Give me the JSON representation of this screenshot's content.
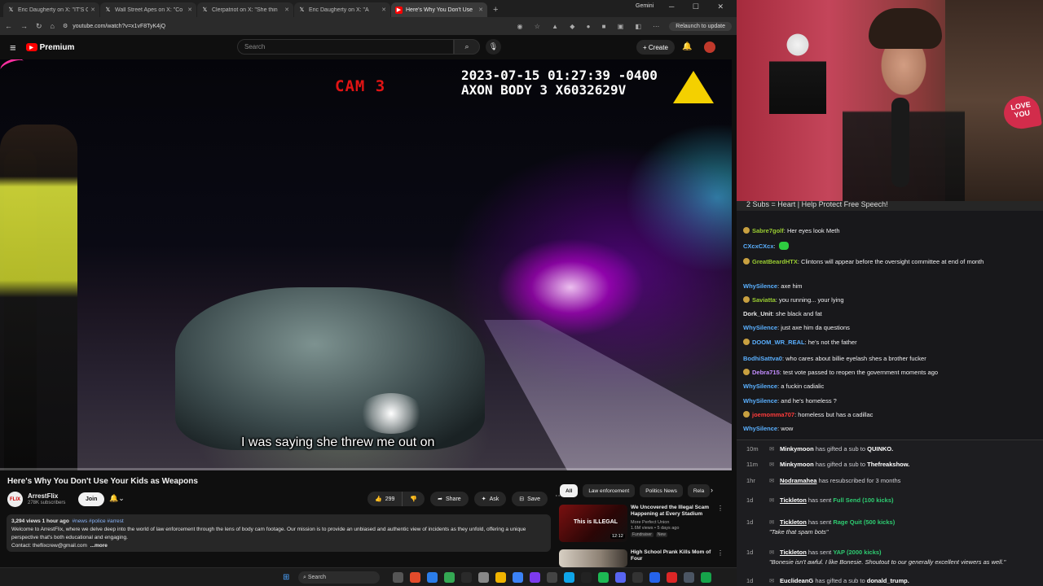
{
  "browser": {
    "tabs": [
      {
        "title": "Eric Daugherty on X: \"IT'S O",
        "icon": "x-icon"
      },
      {
        "title": "Wall Street Apes on X: \"Co",
        "icon": "x-icon"
      },
      {
        "title": "Clerpatriot on X: \"She thin",
        "icon": "x-icon"
      },
      {
        "title": "Eric Daugherty on X: \"A",
        "icon": "x-icon"
      },
      {
        "title": "Here's Why You Don't Use",
        "icon": "youtube-icon",
        "active": true
      }
    ],
    "gemini_label": "Gemini",
    "url": "youtube.com/watch?v=x1vF8TyK4jQ",
    "relaunch_label": "Relaunch to update"
  },
  "youtube": {
    "logo_label": "Premium",
    "search_placeholder": "Search",
    "create_label": "Create",
    "video": {
      "cam_label": "CAM 3",
      "timestamp_line1": "2023-07-15 01:27:39 -0400",
      "timestamp_line2": "AXON BODY 3 X6032629V",
      "caption": "I was saying she threw me out on",
      "progress": 0.0
    },
    "title": "Here's Why You Don't Use Your Kids as Weapons",
    "channel": {
      "name": "ArrestFlix",
      "subscribers": "278K subscribers",
      "avatar_text": "FLIX",
      "join_label": "Join"
    },
    "actions": {
      "likes": "299",
      "share_label": "Share",
      "ask_label": "Ask",
      "save_label": "Save"
    },
    "description": {
      "meta": "3,294 views  1 hour ago",
      "tags": "#news #police #arrest",
      "text": "Welcome to ArrestFlix, where we delve deep into the world of law enforcement through the lens of body cam footage. Our mission is to provide an unbiased and authentic view of incidents as they unfold, offering a unique perspective that's both educational and engaging.",
      "contact": "Contact: theflixcrew@gmail.com",
      "more_label": "...more"
    },
    "chips": [
      "All",
      "Law enforcement",
      "Politics News",
      "Rela"
    ],
    "recommendations": [
      {
        "title": "We Uncovered the Illegal Scam Happening at Every Stadium",
        "channel": "More Perfect Union",
        "meta": "1.6M views • 5 days ago",
        "duration": "12:12",
        "thumb_text": "This is ILLEGAL",
        "badges": [
          "Fundraiser",
          "New"
        ]
      },
      {
        "title": "High School Prank Kills Mom of Four",
        "channel": "",
        "meta": "",
        "duration": "",
        "thumb_text": "",
        "badges": []
      }
    ]
  },
  "taskbar": {
    "search_label": "Search"
  },
  "stream": {
    "banner": "2 Subs = Heart | Help Protect Free Speech!",
    "heart_sign": "LOVE YOU",
    "chat": [
      {
        "user": "Sabre7golf",
        "color": "#9acd32",
        "text": "Her eyes look Meth",
        "badge": true
      },
      {
        "user": "CXcxCXcx",
        "color": "#5ab0ff",
        "text": "",
        "emote": true,
        "badge": false
      },
      {
        "user": "GreatBeardHTX",
        "color": "#9acd32",
        "text": "Clintons will appear before the oversight committee at end of month",
        "badge": true
      },
      {
        "user": "WhySilence",
        "color": "#5ab0ff",
        "text": "axe him",
        "badge": false
      },
      {
        "user": "Saviatta",
        "color": "#9acd32",
        "text": "you running... your lying",
        "badge": true
      },
      {
        "user": "Dork_Unit",
        "color": "#e6e6e6",
        "text": "she black and fat",
        "badge": false
      },
      {
        "user": "WhySilence",
        "color": "#5ab0ff",
        "text": "just axe him da questions",
        "badge": false
      },
      {
        "user": "DOOM_WR_REAL",
        "color": "#5ab0ff",
        "text": "he's not the father",
        "badge": true
      },
      {
        "user": "BodhiSattva0",
        "color": "#5ab0ff",
        "text": "who cares about billie eyelash shes a brother fucker",
        "badge": false
      },
      {
        "user": "Debra715",
        "color": "#c38dff",
        "text": "test vote passed to reopen the government moments ago",
        "badge": true
      },
      {
        "user": "WhySilence",
        "color": "#5ab0ff",
        "text": "a fuckin cadialic",
        "badge": false
      },
      {
        "user": "WhySilence",
        "color": "#5ab0ff",
        "text": "and he's homeless ?",
        "badge": false
      },
      {
        "user": "joemomma707",
        "color": "#ff3b3b",
        "text": "homeless but has a cadillac",
        "badge": true
      },
      {
        "user": "WhySilence",
        "color": "#5ab0ff",
        "text": "wow",
        "badge": false
      }
    ],
    "events": [
      {
        "time": "10m",
        "user": "Minkymoon",
        "text": "has gifted a sub to",
        "target": "QUINKO."
      },
      {
        "time": "11m",
        "user": "Minkymoon",
        "text": "has gifted a sub to",
        "target": "Thefreakshow."
      },
      {
        "time": "1hr",
        "user": "Nodramahea",
        "text": "has resubscribed for 3 months",
        "target": ""
      },
      {
        "time": "1d",
        "user": "Tickleton",
        "text": "has sent",
        "target": "Full Send (100 kicks)",
        "quote": ""
      },
      {
        "time": "1d",
        "user": "Tickleton",
        "text": "has sent",
        "target": "Rage Quit (500 kicks)",
        "quote": "\"Take that spam bots\""
      },
      {
        "time": "1d",
        "user": "Tickleton",
        "text": "has sent",
        "target": "YAP (2000 kicks)",
        "quote": "\"Bonesie isn't awful. I like Bonesie. Shoutout to our generally excellent viewers as well.\""
      },
      {
        "time": "1d",
        "user": "EuclideanG",
        "text": "has gifted a sub to",
        "target": "donald_trump."
      }
    ]
  }
}
